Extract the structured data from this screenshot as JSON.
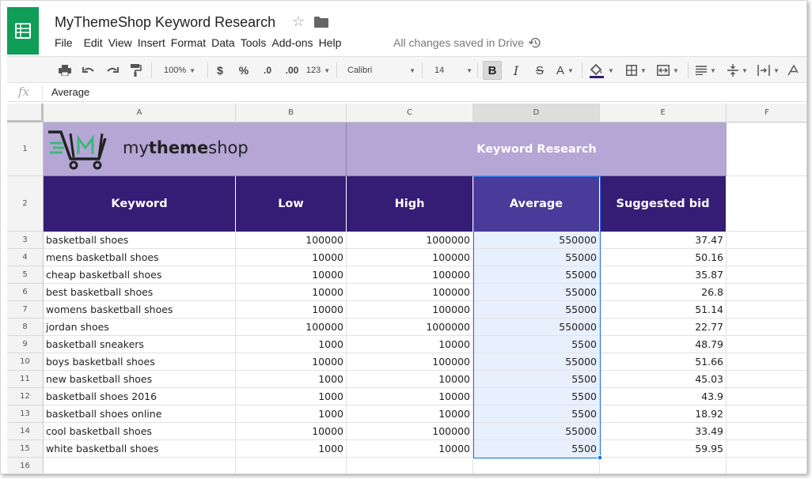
{
  "app": {
    "doc_title": "MyThemeShop Keyword Research",
    "save_status": "All changes saved in Drive",
    "menu": [
      "File",
      "Edit",
      "View",
      "Insert",
      "Format",
      "Data",
      "Tools",
      "Add-ons",
      "Help"
    ]
  },
  "toolbar": {
    "zoom": "100%",
    "currency": "$",
    "percent": "%",
    "decimal_decrease": ".0",
    "decimal_increase": ".00",
    "more_formats": "123",
    "font": "Calibri",
    "font_size": "14",
    "bold": "B",
    "italic": "I",
    "strikethrough": "S",
    "text_color": "A"
  },
  "formula_bar": {
    "fx_label": "fx",
    "value": "Average"
  },
  "sheet": {
    "columns": [
      "A",
      "B",
      "C",
      "D",
      "E",
      "F"
    ],
    "active_column": "D",
    "row_numbers": [
      "1",
      "2",
      "3",
      "4",
      "5",
      "6",
      "7",
      "8",
      "9",
      "10",
      "11",
      "12",
      "13",
      "14",
      "15",
      "16"
    ],
    "logo": {
      "brand_light": "mytheme",
      "brand_bold": "",
      "brand_tail": "shop",
      "brand_mid": "theme"
    },
    "banner_title": "Keyword Research",
    "headers": [
      "Keyword",
      "Low",
      "High",
      "Average",
      "Suggested bid"
    ],
    "rows": [
      [
        "basketball shoes",
        "100000",
        "1000000",
        "550000",
        "37.47"
      ],
      [
        "mens basketball shoes",
        "10000",
        "100000",
        "55000",
        "50.16"
      ],
      [
        "cheap basketball shoes",
        "10000",
        "100000",
        "55000",
        "35.87"
      ],
      [
        "best basketball shoes",
        "10000",
        "100000",
        "55000",
        "26.8"
      ],
      [
        "womens basketball shoes",
        "10000",
        "100000",
        "55000",
        "51.14"
      ],
      [
        "jordan shoes",
        "100000",
        "1000000",
        "550000",
        "22.77"
      ],
      [
        "basketball sneakers",
        "1000",
        "10000",
        "5500",
        "48.79"
      ],
      [
        "boys basketball shoes",
        "10000",
        "100000",
        "55000",
        "51.66"
      ],
      [
        "new basketball shoes",
        "1000",
        "10000",
        "5500",
        "45.03"
      ],
      [
        "basketball shoes 2016",
        "1000",
        "10000",
        "5500",
        "43.9"
      ],
      [
        "basketball shoes online",
        "1000",
        "10000",
        "5500",
        "18.92"
      ],
      [
        "cool basketball shoes",
        "10000",
        "100000",
        "55000",
        "33.49"
      ],
      [
        "white basketball shoes",
        "1000",
        "10000",
        "5500",
        "59.95"
      ]
    ]
  },
  "colors": {
    "banner": "#b4a7d6",
    "header": "#351c75",
    "selection": "#1a73e8",
    "app_green": "#0f9d58",
    "logo_green": "#3cb878"
  }
}
